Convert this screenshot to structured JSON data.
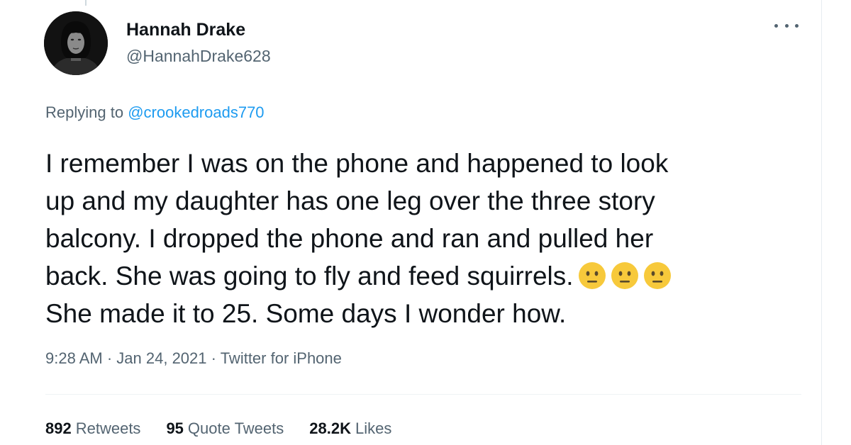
{
  "author": {
    "name": "Hannah Drake",
    "handle": "@HannahDrake628"
  },
  "reply": {
    "prefix": "Replying to",
    "to": "@crookedroads770"
  },
  "tweet": {
    "lines": [
      "I remember I was on the phone and happened to look",
      "up and my daughter has one leg over the three story",
      "balcony. I dropped the phone and ran and pulled her",
      "back. She was going to fly and feed squirrels.",
      "She made it to 25. Some days I wonder how."
    ],
    "emojis": [
      "neutral-face-emoji",
      "neutral-face-emoji",
      "neutral-face-emoji"
    ]
  },
  "meta": {
    "time": "9:28 AM",
    "date": "Jan 24, 2021",
    "source": "Twitter for iPhone",
    "separator": "·"
  },
  "stats": {
    "retweets_count": "892",
    "retweets_label": "Retweets",
    "quote_count": "95",
    "quote_label": "Quote Tweets",
    "likes_count": "28.2K",
    "likes_label": "Likes"
  },
  "colors": {
    "link": "#1d9bf0",
    "secondary_text": "#536471",
    "primary_text": "#0f1419",
    "emoji_yellow": "#f7c93b"
  },
  "icons": {
    "more": "more-horizontal-icon"
  }
}
